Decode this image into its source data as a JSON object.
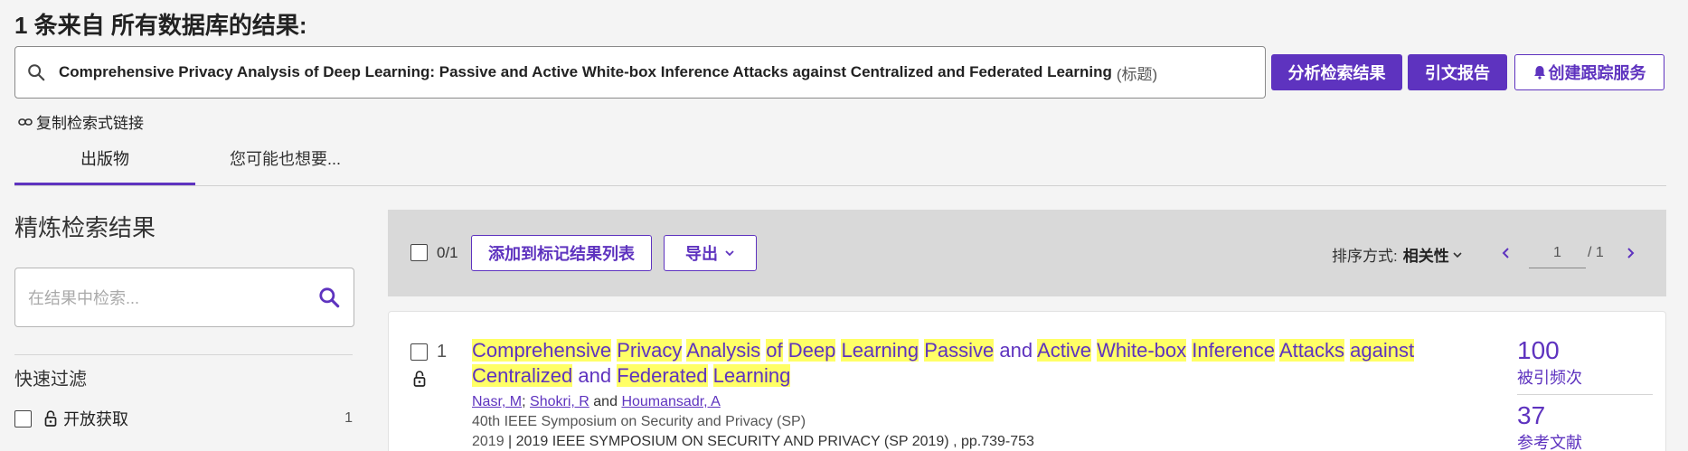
{
  "header": {
    "results_heading": "1 条来自 所有数据库的结果:"
  },
  "query": {
    "text": "Comprehensive Privacy Analysis of Deep Learning: Passive and Active White-box Inference Attacks against Centralized and Federated Learning",
    "field": "(标题)"
  },
  "actions": {
    "analyze": "分析检索结果",
    "citation_report": "引文报告",
    "create_alert": "创建跟踪服务",
    "copy_link": "复制检索式链接"
  },
  "tabs": [
    {
      "label": "出版物",
      "active": true
    },
    {
      "label": "您可能也想要..."
    }
  ],
  "sidebar": {
    "refine_title": "精炼检索结果",
    "search_placeholder": "在结果中检索...",
    "quick_filters_title": "快速过滤",
    "filters": [
      {
        "label": "开放获取",
        "count": "1"
      }
    ]
  },
  "toolbar": {
    "selected": "0/1",
    "add_to_marked": "添加到标记结果列表",
    "export": "导出",
    "sort_label": "排序方式:",
    "sort_value": "相关性",
    "page_current": "1",
    "page_total": "/ 1"
  },
  "results": [
    {
      "index": "1",
      "title_words": [
        "Comprehensive",
        "Privacy",
        "Analysis",
        "of",
        "Deep",
        "Learning",
        "Passive",
        "and",
        "Active",
        "White-box",
        "Inference",
        "Attacks",
        "against",
        "Centralized",
        "and",
        "Federated",
        "Learning"
      ],
      "title_highlight": [
        true,
        true,
        true,
        true,
        true,
        true,
        true,
        false,
        true,
        true,
        true,
        true,
        true,
        true,
        false,
        true,
        true
      ],
      "authors": [
        "Nasr, M",
        "Shokri, R",
        "Houmansadr, A"
      ],
      "author_sep1": ";",
      "author_sep2": "and",
      "source": "40th IEEE Symposium on Security and Privacy (SP)",
      "year": "2019",
      "details": "| 2019 IEEE SYMPOSIUM ON SECURITY AND PRIVACY (SP 2019) , pp.739-753",
      "citations": "100",
      "citations_label": "被引频次",
      "references": "37",
      "references_label": "参考文献"
    }
  ],
  "colors": {
    "accent": "#5e33bf",
    "highlight": "#ffff66",
    "background": "#f4f4f4",
    "toolbar_bg": "#d9d9d9"
  }
}
